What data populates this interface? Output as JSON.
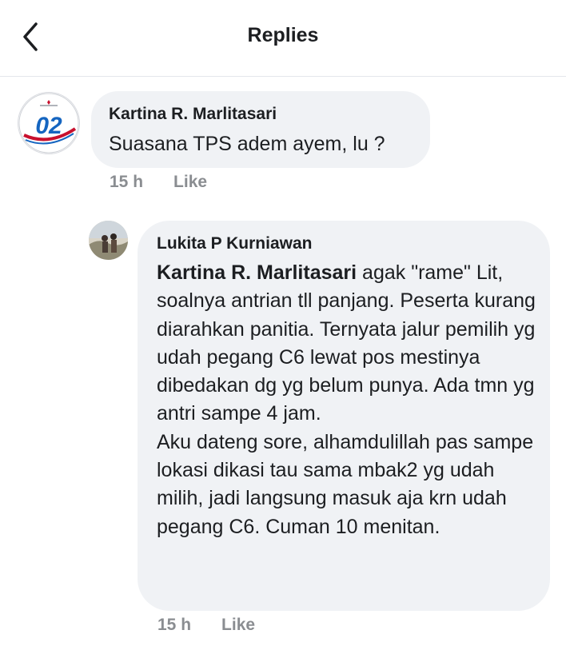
{
  "header": {
    "title": "Replies",
    "back_icon": "chevron-left-icon"
  },
  "comments": [
    {
      "author": "Kartina R. Marlitasari",
      "text": "Suasana TPS adem ayem, lu ?",
      "time": "15 h",
      "like_label": "Like",
      "avatar_label": "02"
    },
    {
      "author": "Lukita P Kurniawan",
      "mention": "Kartina R. Marlitasari",
      "text": " agak \"rame\" Lit, soalnya antrian tll panjang. Peserta kurang diarahkan panitia. Ternyata jalur pemilih yg udah pegang C6 lewat pos mestinya dibedakan dg yg belum punya. Ada tmn yg antri sampe 4 jam.",
      "text2": "Aku dateng sore, alhamdulillah pas sampe lokasi dikasi tau sama mbak2 yg udah milih, jadi langsung masuk aja krn udah pegang C6. Cuman 10 menitan.",
      "time": "15 h",
      "like_label": "Like"
    }
  ],
  "colors": {
    "bubble": "#f0f2f5",
    "meta": "#8a8d91",
    "text": "#1c1e21"
  }
}
